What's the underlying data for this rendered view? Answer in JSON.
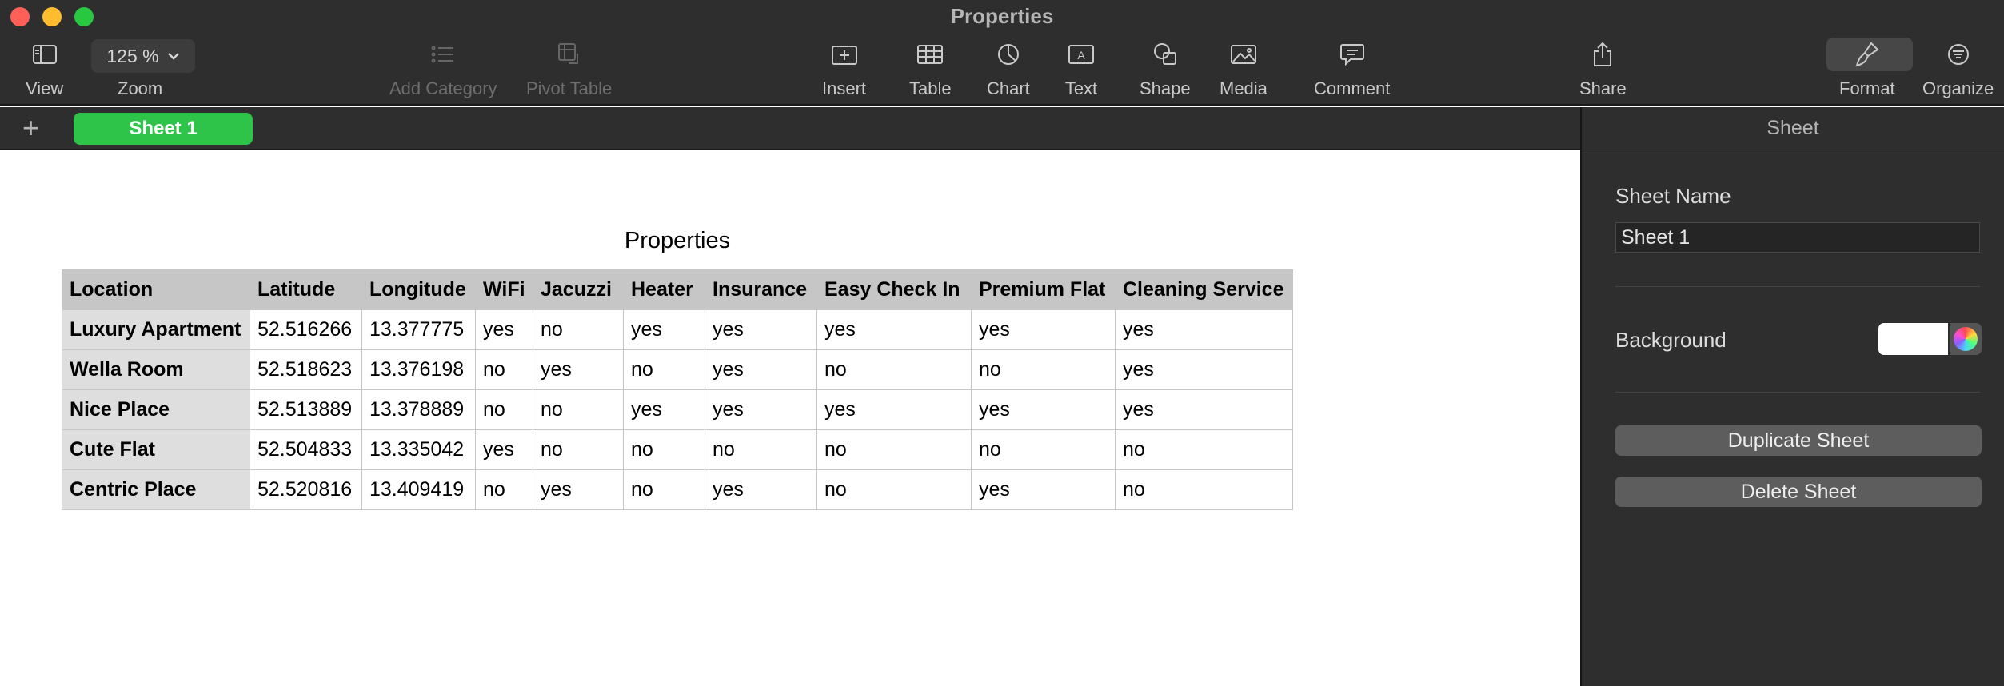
{
  "window": {
    "title": "Properties"
  },
  "toolbar": {
    "zoom_value": "125 %",
    "items": {
      "view": "View",
      "zoom": "Zoom",
      "add_category": "Add Category",
      "pivot_table": "Pivot Table",
      "insert": "Insert",
      "table": "Table",
      "chart": "Chart",
      "text": "Text",
      "shape": "Shape",
      "media": "Media",
      "comment": "Comment",
      "share": "Share",
      "format": "Format",
      "organize": "Organize"
    }
  },
  "sheets": {
    "add_symbol": "+",
    "active": "Sheet 1"
  },
  "table": {
    "title": "Properties",
    "columns": [
      "Location",
      "Latitude",
      "Longitude",
      "WiFi",
      "Jacuzzi",
      "Heater",
      "Insurance",
      "Easy Check In",
      "Premium Flat",
      "Cleaning Service"
    ],
    "rows": [
      [
        "Luxury Apartment",
        "52.516266",
        "13.377775",
        "yes",
        "no",
        "yes",
        "yes",
        "yes",
        "yes",
        "yes"
      ],
      [
        "Wella Room",
        "52.518623",
        "13.376198",
        "no",
        "yes",
        "no",
        "yes",
        "no",
        "no",
        "yes"
      ],
      [
        "Nice Place",
        "52.513889",
        "13.378889",
        "no",
        "no",
        "yes",
        "yes",
        "yes",
        "yes",
        "yes"
      ],
      [
        "Cute Flat",
        "52.504833",
        "13.335042",
        "yes",
        "no",
        "no",
        "no",
        "no",
        "no",
        "no"
      ],
      [
        "Centric Place",
        "52.520816",
        "13.409419",
        "no",
        "yes",
        "no",
        "yes",
        "no",
        "yes",
        "no"
      ]
    ]
  },
  "inspector": {
    "title": "Sheet",
    "sheet_name_label": "Sheet Name",
    "sheet_name_value": "Sheet 1",
    "background_label": "Background",
    "background_color": "#ffffff",
    "duplicate_button": "Duplicate Sheet",
    "delete_button": "Delete Sheet"
  },
  "colors": {
    "accent_tab": "#2ec44a",
    "toolbar_bg": "#2e2e2e"
  }
}
